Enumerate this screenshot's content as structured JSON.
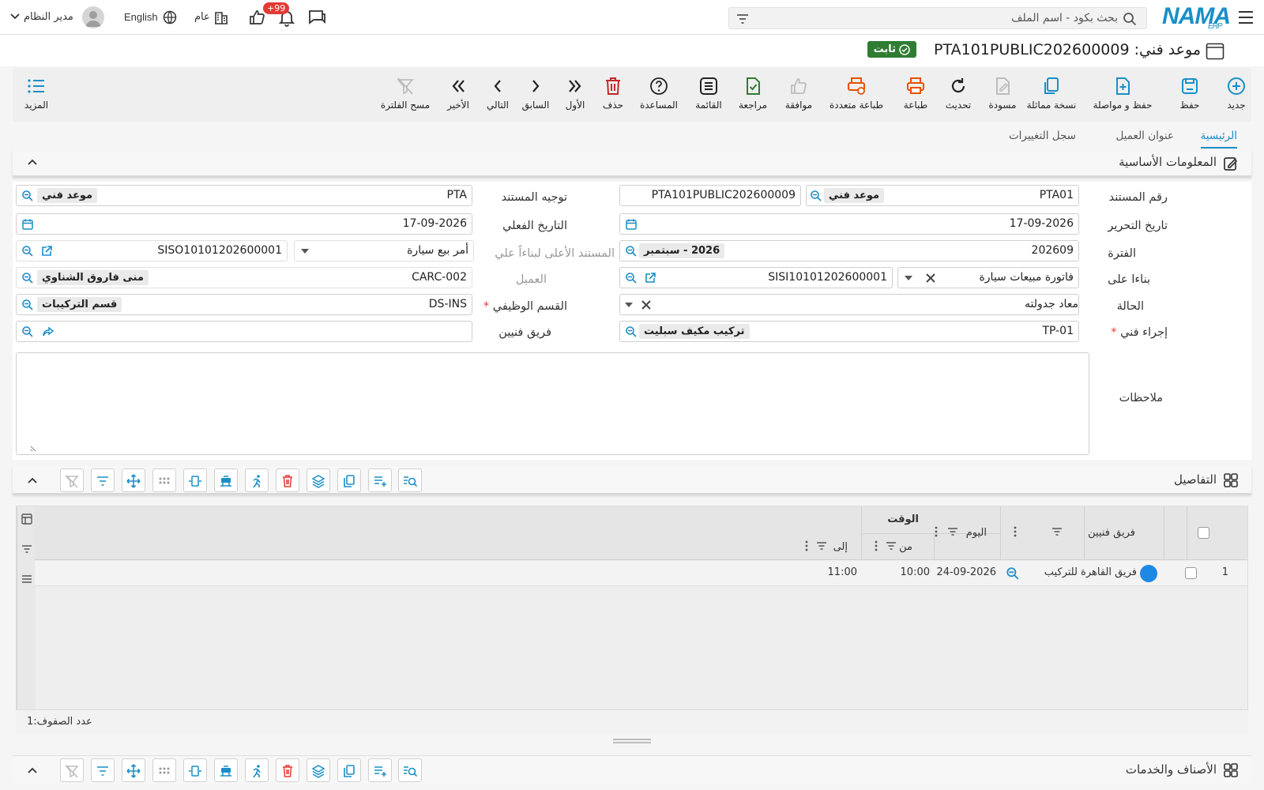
{
  "topbar": {
    "logo": "NAMA",
    "logo_sub": "ERP",
    "search_placeholder": "بحث بكود - اسم الملف",
    "user": "مدير النظام",
    "language": "English",
    "branch": "عام",
    "notifications_count": "+99"
  },
  "document": {
    "title": "موعد فني: PTA101PUBLIC202600009",
    "status": "ثابت"
  },
  "toolbar": {
    "new": "جديد",
    "save": "حفظ",
    "save_continue": "حفظ و مواصلة",
    "copy": "نسخة مماثلة",
    "draft": "مسودة",
    "refresh": "تحديث",
    "print": "طباعة",
    "multi_print": "طباعة متعددة",
    "approve": "موافقة",
    "review": "مراجعة",
    "list": "القائمة",
    "help": "المساعدة",
    "delete": "حذف",
    "first": "الأول",
    "previous": "السابق",
    "next": "التالي",
    "last": "الأخير",
    "clear_filter": "مسح الفلترة",
    "more": "المزيد"
  },
  "tabs": [
    "الرئيسية",
    "عنوان العميل",
    "سجل التغييرات"
  ],
  "basic_info": {
    "section_title": "المعلومات الأساسية",
    "doc_number_label": "رقم المستند",
    "doc_number_code": "PTA01",
    "doc_number_type": "موعد فني",
    "doc_number_value": "PTA101PUBLIC202600009",
    "doc_direction_label": "توجيه المستند",
    "doc_direction_code": "PTA",
    "doc_direction_type": "موعد فني",
    "edit_date_label": "تاريخ التحرير",
    "edit_date": "17-09-2026",
    "actual_date_label": "التاريخ الفعلي",
    "actual_date": "17-09-2026",
    "period_label": "الفترة",
    "period_code": "202609",
    "period_name": "2026 - سبتمبر",
    "parent_doc_label": "المستند الأعلى لبناءاً علي",
    "parent_doc_type": "أمر بيع سيارة",
    "parent_doc_number": "SISO10101202600001",
    "based_on_label": "بناءا على",
    "based_on_type": "فاتورة مبيعات سيارة",
    "based_on_number": "SISI10101202600001",
    "customer_label": "العميل",
    "customer_code": "CARC-002",
    "customer_name": "منى فاروق الشناوي",
    "status_label": "الحالة",
    "status_value": "معاد جدولته",
    "department_label": "القسم الوظيفي",
    "department_code": "DS-INS",
    "department_name": "قسم التركيبات",
    "procedure_label": "إجراء فني",
    "procedure_code": "TP-01",
    "procedure_name": "تركيب مكيف سبليت",
    "team_label": "فريق فنيين",
    "notes_label": "ملاحظات",
    "required_mark": "*"
  },
  "details": {
    "section_title": "التفاصيل",
    "col_team": "فريق فنيين",
    "col_day": "اليوم",
    "col_time": "الوقت",
    "col_from": "من",
    "col_to": "إلى",
    "rows": [
      {
        "num": "1",
        "team": "فريق القاهرة للتركيب",
        "day": "24-09-2026",
        "from": "10:00",
        "to": "11:00"
      }
    ],
    "row_count": "عدد الصفوف:1"
  },
  "items_section": {
    "section_title": "الأصناف والخدمات"
  },
  "colors": {
    "accent": "#1a8fc7",
    "status_green": "#2e7d32",
    "badge_red": "#e53935",
    "delete_red": "#c62828",
    "print_orange": "#e65100"
  }
}
